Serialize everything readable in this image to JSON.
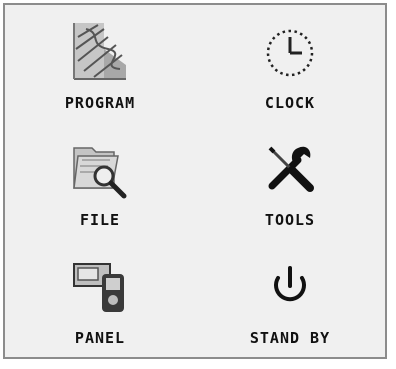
{
  "menu": {
    "items": [
      {
        "label": "PROGRAM",
        "icon": "program-icon"
      },
      {
        "label": "CLOCK",
        "icon": "clock-icon"
      },
      {
        "label": "FILE",
        "icon": "file-icon"
      },
      {
        "label": "TOOLS",
        "icon": "tools-icon"
      },
      {
        "label": "PANEL",
        "icon": "panel-icon"
      },
      {
        "label": "STAND BY",
        "icon": "standby-icon"
      }
    ]
  }
}
